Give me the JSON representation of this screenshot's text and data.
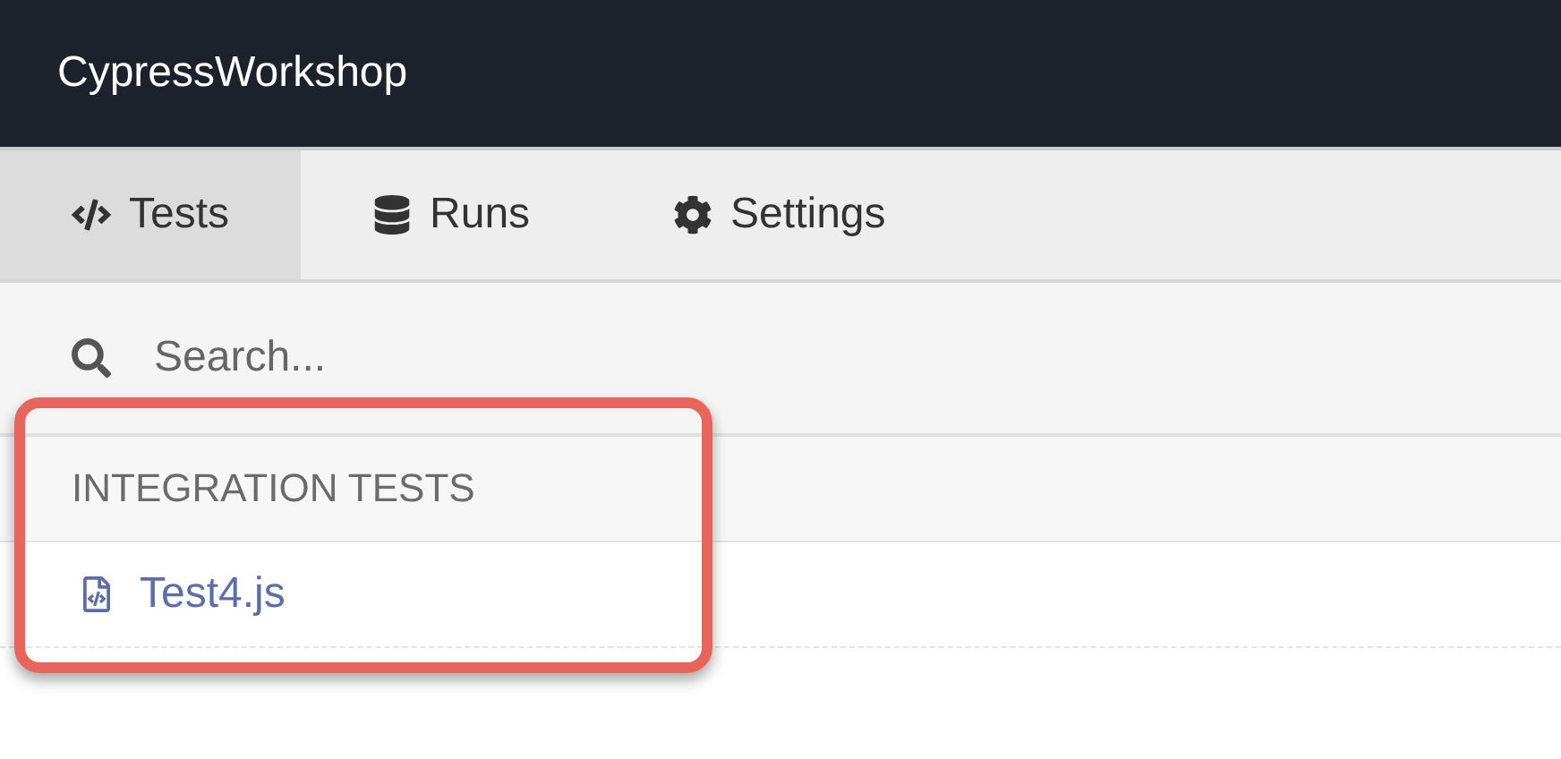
{
  "header": {
    "title": "CypressWorkshop"
  },
  "tabs": [
    {
      "label": "Tests",
      "selected": true
    },
    {
      "label": "Runs",
      "selected": false
    },
    {
      "label": "Settings",
      "selected": false
    }
  ],
  "search": {
    "placeholder": "Search..."
  },
  "sections": [
    {
      "heading": "INTEGRATION TESTS",
      "files": [
        {
          "name": "Test4.js"
        }
      ]
    }
  ]
}
